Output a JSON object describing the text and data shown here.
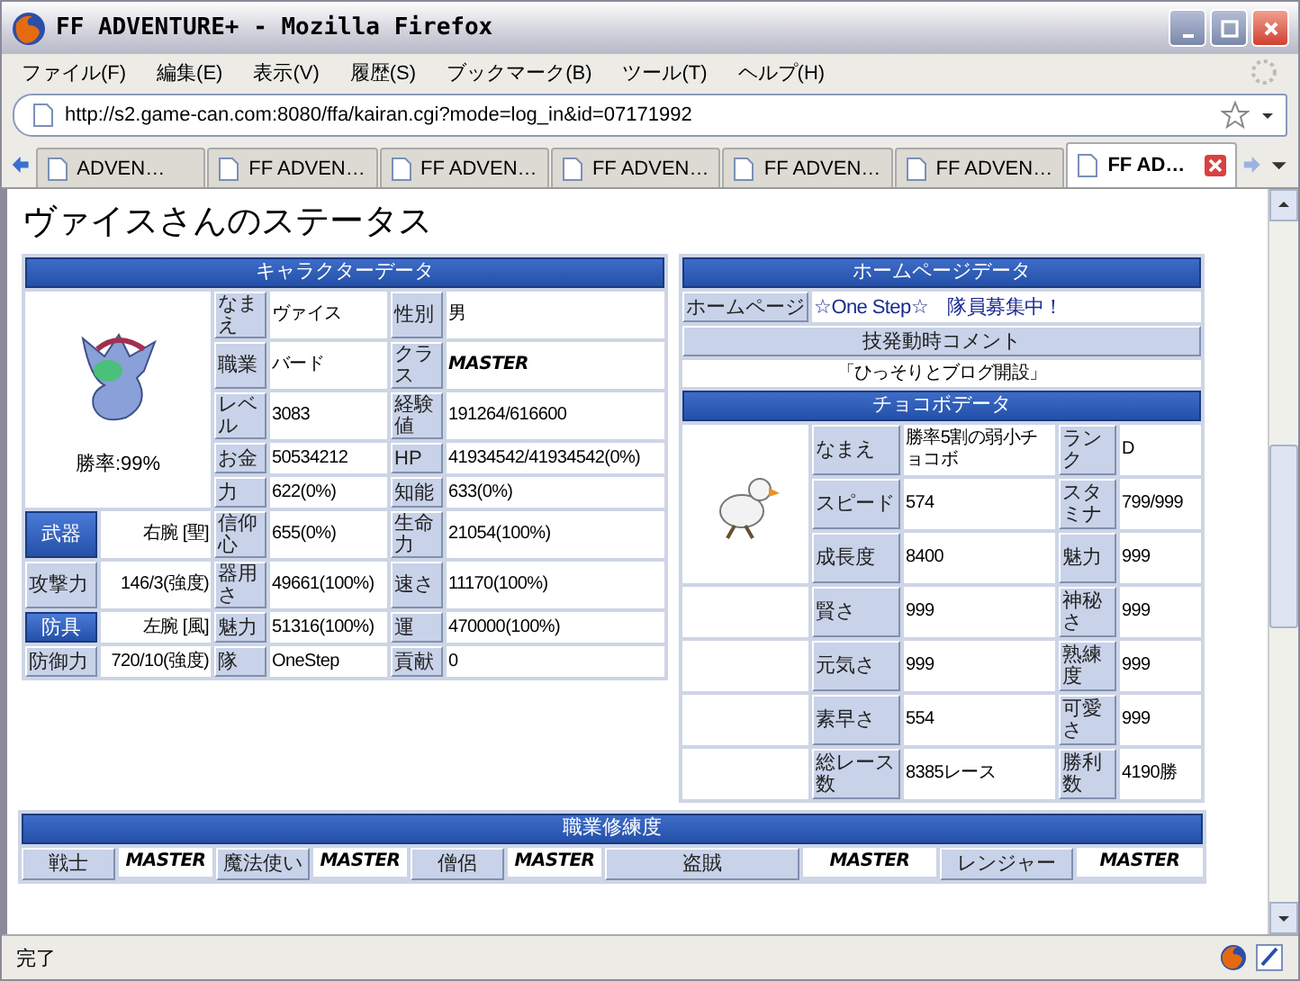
{
  "window": {
    "title": "FF ADVENTURE+ - Mozilla Firefox"
  },
  "menu": [
    "ファイル(F)",
    "編集(E)",
    "表示(V)",
    "履歴(S)",
    "ブックマーク(B)",
    "ツール(T)",
    "ヘルプ(H)"
  ],
  "address_bar": {
    "value": "http://s2.game-can.com:8080/ffa/kairan.cgi?mode=log_in&id=07171992"
  },
  "tabs": [
    {
      "label": "ADVEN…",
      "selected": false
    },
    {
      "label": "FF ADVEN…",
      "selected": false
    },
    {
      "label": "FF ADVEN…",
      "selected": false
    },
    {
      "label": "FF ADVEN…",
      "selected": false
    },
    {
      "label": "FF ADVEN…",
      "selected": false
    },
    {
      "label": "FF ADVEN…",
      "selected": false
    },
    {
      "label": "FF AD…",
      "selected": true
    }
  ],
  "page": {
    "heading": "ヴァイスさんのステータス",
    "character": {
      "title": "キャラクターデータ",
      "caption": "勝率:99%",
      "rows": [
        [
          {
            "kind": "label",
            "text": "なまえ"
          },
          {
            "kind": "value",
            "text": "ヴァイス"
          },
          {
            "kind": "label",
            "text": "性別"
          },
          {
            "kind": "value",
            "text": "男"
          }
        ],
        [
          {
            "kind": "label",
            "text": "職業"
          },
          {
            "kind": "value",
            "text": "バード"
          },
          {
            "kind": "label",
            "text": "クラス"
          },
          {
            "kind": "master",
            "text": "MASTER"
          }
        ],
        [
          {
            "kind": "label",
            "text": "レベル"
          },
          {
            "kind": "value",
            "text": "3083"
          },
          {
            "kind": "label",
            "text": "経験値"
          },
          {
            "kind": "value",
            "text": "191264/616600"
          }
        ],
        [
          {
            "kind": "label",
            "text": "お金"
          },
          {
            "kind": "value",
            "text": "50534212"
          },
          {
            "kind": "label",
            "text": "HP"
          },
          {
            "kind": "value",
            "text": "41934542/41934542(0%)"
          }
        ],
        [
          {
            "kind": "label",
            "text": "力"
          },
          {
            "kind": "value",
            "text": "622(0%)"
          },
          {
            "kind": "label",
            "text": "知能"
          },
          {
            "kind": "value",
            "text": "633(0%)"
          }
        ],
        [
          {
            "kind": "button",
            "text": "武器"
          },
          {
            "kind": "right",
            "text": "右腕 [聖]"
          },
          {
            "kind": "label",
            "text": "信仰心"
          },
          {
            "kind": "value",
            "text": "655(0%)"
          },
          {
            "kind": "label",
            "text": "生命力"
          },
          {
            "kind": "value",
            "text": "21054(100%)"
          }
        ],
        [
          {
            "kind": "label",
            "text": "攻撃力"
          },
          {
            "kind": "right",
            "text": "146/3(強度)"
          },
          {
            "kind": "label",
            "text": "器用さ"
          },
          {
            "kind": "value",
            "text": "49661(100%)"
          },
          {
            "kind": "label",
            "text": "速さ"
          },
          {
            "kind": "value",
            "text": "11170(100%)"
          }
        ],
        [
          {
            "kind": "button",
            "text": "防具"
          },
          {
            "kind": "right",
            "text": "左腕 [風]"
          },
          {
            "kind": "label",
            "text": "魅力"
          },
          {
            "kind": "value",
            "text": "51316(100%)"
          },
          {
            "kind": "label",
            "text": "運"
          },
          {
            "kind": "value",
            "text": "470000(100%)"
          }
        ],
        [
          {
            "kind": "label",
            "text": "防御力"
          },
          {
            "kind": "right",
            "text": "720/10(強度)"
          },
          {
            "kind": "label",
            "text": "隊"
          },
          {
            "kind": "value",
            "text": "OneStep"
          },
          {
            "kind": "label",
            "text": "貢献"
          },
          {
            "kind": "value",
            "text": "0"
          }
        ]
      ]
    },
    "homepage": {
      "title": "ホームページデータ",
      "label": "ホームページ",
      "value": "☆One Step☆　隊員募集中！",
      "comment_label": "技発動時コメント",
      "comment": "「ひっそりとブログ開設」"
    },
    "chocobo": {
      "title": "チョコボデータ",
      "rows": [
        [
          {
            "kind": "label",
            "text": "なまえ"
          },
          {
            "kind": "value",
            "text": "勝率5割の弱小チョコボ"
          },
          {
            "kind": "label",
            "text": "ランク"
          },
          {
            "kind": "value",
            "text": "D"
          }
        ],
        [
          {
            "kind": "label",
            "text": "スピード"
          },
          {
            "kind": "value",
            "text": "574"
          },
          {
            "kind": "label",
            "text": "スタミナ"
          },
          {
            "kind": "value",
            "text": "799/999"
          }
        ],
        [
          {
            "kind": "label",
            "text": "成長度"
          },
          {
            "kind": "value",
            "text": "8400"
          },
          {
            "kind": "label",
            "text": "魅力"
          },
          {
            "kind": "value",
            "text": "999"
          }
        ],
        [
          {
            "kind": "label",
            "text": "賢さ"
          },
          {
            "kind": "value",
            "text": "999"
          },
          {
            "kind": "label",
            "text": "神秘さ"
          },
          {
            "kind": "value",
            "text": "999"
          }
        ],
        [
          {
            "kind": "label",
            "text": "元気さ"
          },
          {
            "kind": "value",
            "text": "999"
          },
          {
            "kind": "label",
            "text": "熟練度"
          },
          {
            "kind": "value",
            "text": "999"
          }
        ],
        [
          {
            "kind": "label",
            "text": "素早さ"
          },
          {
            "kind": "value",
            "text": "554"
          },
          {
            "kind": "label",
            "text": "可愛さ"
          },
          {
            "kind": "value",
            "text": "999"
          }
        ],
        [
          {
            "kind": "label",
            "text": "総レース数"
          },
          {
            "kind": "value",
            "text": "8385レース"
          },
          {
            "kind": "label",
            "text": "勝利数"
          },
          {
            "kind": "value",
            "text": "4190勝"
          }
        ]
      ]
    },
    "job_mastery": {
      "title": "職業修練度",
      "items": [
        {
          "job": "戦士",
          "level": "MASTER"
        },
        {
          "job": "魔法使い",
          "level": "MASTER"
        },
        {
          "job": "僧侶",
          "level": "MASTER"
        },
        {
          "job": "盗賊",
          "level": "MASTER"
        },
        {
          "job": "レンジャー",
          "level": "MASTER"
        }
      ]
    }
  },
  "status_bar": {
    "text": "完了"
  }
}
